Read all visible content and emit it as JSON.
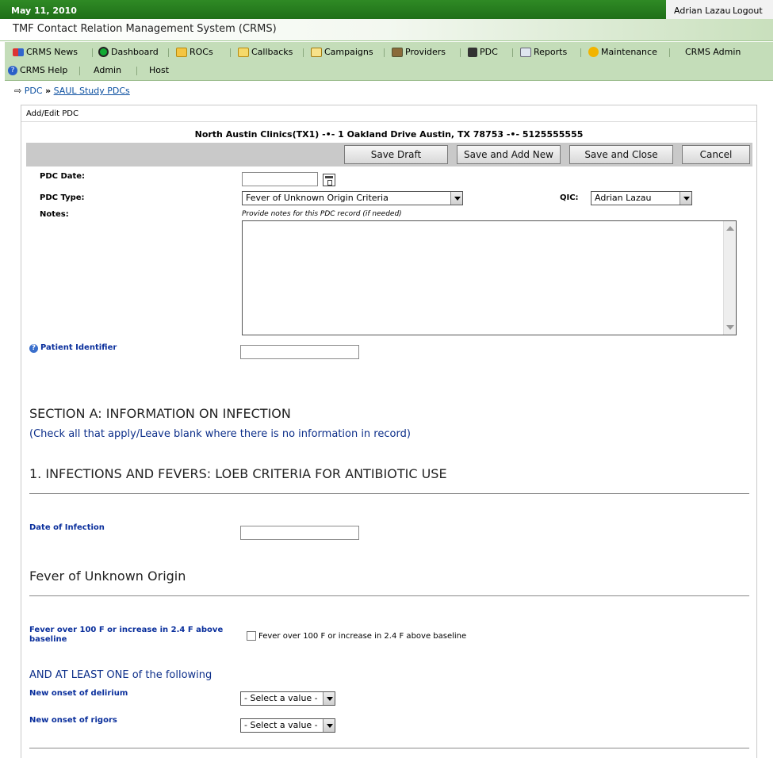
{
  "header": {
    "date": "May 11, 2010",
    "user": "Adrian Lazau",
    "logout": "Logout",
    "app_title": "TMF Contact Relation Management System (CRMS)"
  },
  "menu": {
    "row1": [
      {
        "label": "CRMS News",
        "icon": "news-icon"
      },
      {
        "label": "Dashboard",
        "icon": "dashboard-icon"
      },
      {
        "label": "ROCs",
        "icon": "rocs-icon"
      },
      {
        "label": "Callbacks",
        "icon": "callbacks-icon"
      },
      {
        "label": "Campaigns",
        "icon": "campaigns-icon"
      },
      {
        "label": "Providers",
        "icon": "providers-icon"
      },
      {
        "label": "PDC",
        "icon": "pdc-icon"
      },
      {
        "label": "Reports",
        "icon": "reports-icon"
      },
      {
        "label": "Maintenance",
        "icon": "maintenance-icon"
      },
      {
        "label": "CRMS Admin",
        "icon": ""
      }
    ],
    "row2": [
      {
        "label": "CRMS Help",
        "icon": "help-icon"
      },
      {
        "label": "Admin",
        "icon": ""
      },
      {
        "label": "Host",
        "icon": ""
      }
    ]
  },
  "breadcrumb": {
    "root": "PDC",
    "separator": "»",
    "current": "SAUL Study PDCs"
  },
  "panel": {
    "title": "Add/Edit PDC",
    "clinic_info": "North Austin Clinics(TX1)  -•-  1 Oakland Drive Austin, TX 78753  -•-  5125555555",
    "buttons": {
      "save_draft": "Save Draft",
      "save_add_new": "Save and Add New",
      "save_close": "Save and Close",
      "cancel": "Cancel"
    }
  },
  "form": {
    "pdc_date_label": "PDC Date:",
    "pdc_date_value": "",
    "pdc_type_label": "PDC Type:",
    "pdc_type_value": "Fever of Unknown Origin Criteria",
    "qic_label": "QIC:",
    "qic_value": "Adrian Lazau",
    "notes_label": "Notes:",
    "notes_hint": "Provide notes for this PDC record (if needed)",
    "notes_value": "",
    "patient_identifier_label": "Patient Identifier",
    "patient_identifier_value": ""
  },
  "section_a": {
    "title": "SECTION A: INFORMATION ON INFECTION",
    "subtitle": "(Check all that apply/Leave blank where there is no information in record)",
    "heading1": "1. INFECTIONS AND FEVERS: LOEB CRITERIA FOR ANTIBIOTIC USE",
    "date_of_infection_label": "Date of Infection",
    "date_of_infection_value": "",
    "fuo_heading": "Fever of Unknown Origin",
    "fever_label": "Fever over 100 F or increase in 2.4 F above baseline",
    "fever_checkbox_text": "Fever over 100 F or increase in 2.4 F above baseline",
    "and_at_least": "AND AT LEAST ONE of the following",
    "delirium_label": "New onset of delirium",
    "delirium_value": "- Select a value -",
    "rigors_label": "New onset of rigors",
    "rigors_value": "- Select a value -"
  }
}
